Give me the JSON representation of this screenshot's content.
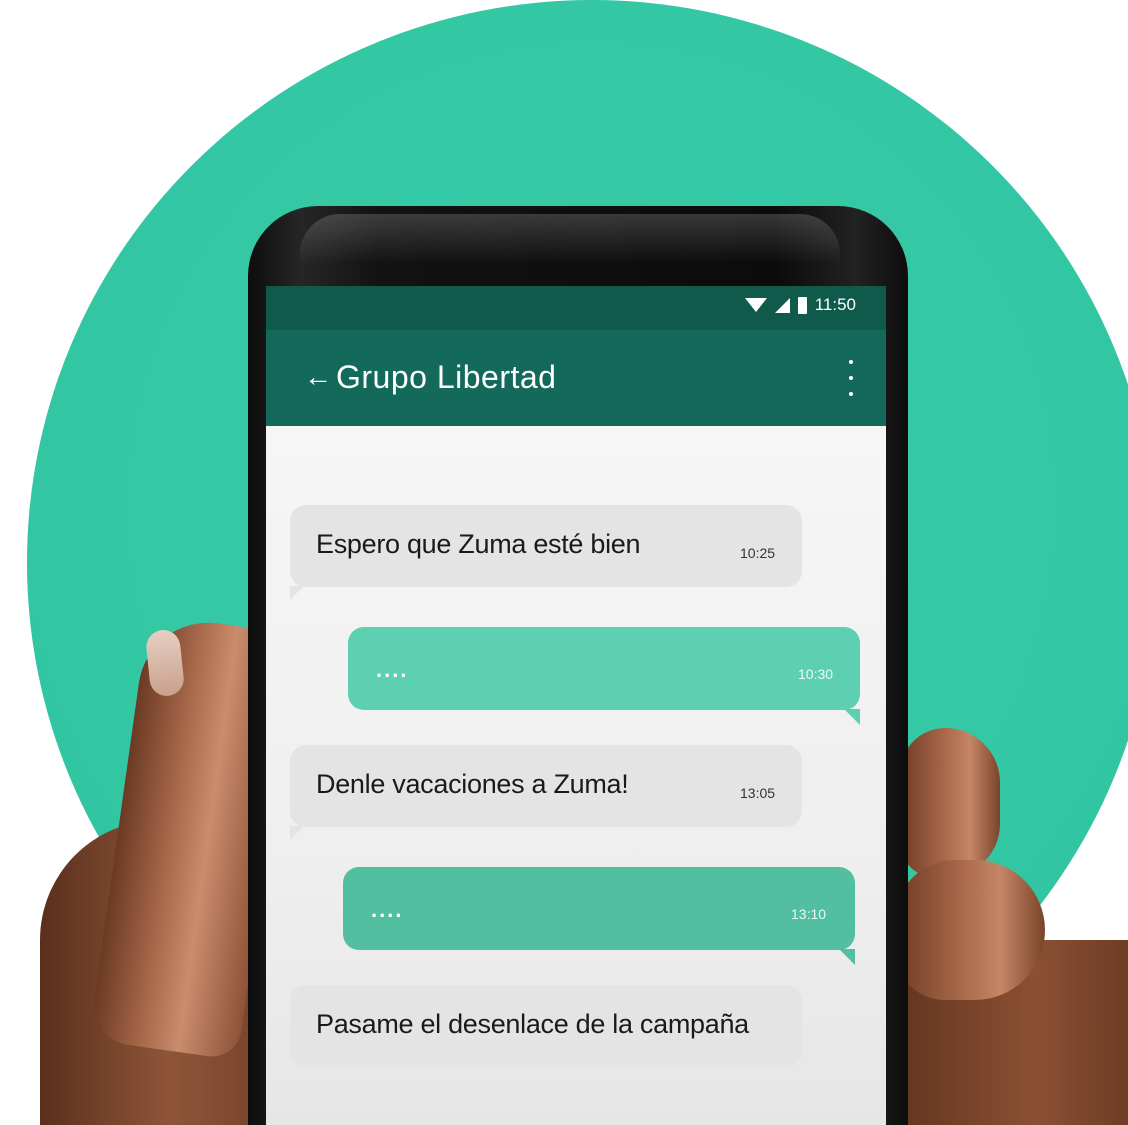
{
  "status_bar": {
    "time": "11:50",
    "icons": [
      "wifi-icon",
      "signal-icon",
      "battery-icon"
    ]
  },
  "app_bar": {
    "back_icon": "←",
    "title": "Grupo Libertad",
    "menu_icon": "more-vertical-icon"
  },
  "messages": [
    {
      "direction": "incoming",
      "text": "Espero que Zuma esté bien",
      "time": "10:25"
    },
    {
      "direction": "outgoing",
      "text": "....",
      "time": "10:30"
    },
    {
      "direction": "incoming",
      "text": "Denle vacaciones a Zuma!",
      "time": "13:05"
    },
    {
      "direction": "outgoing",
      "text": "....",
      "time": "13:10"
    },
    {
      "direction": "incoming",
      "text": "Pasame el desenlace de la campaña",
      "time": ""
    }
  ],
  "colors": {
    "background_circle": "#38cda9",
    "status_bar": "#0f5a4b",
    "app_bar": "#13695a",
    "incoming_bubble": "#e4e4e4",
    "outgoing_bubble": "#5cd0b0"
  }
}
